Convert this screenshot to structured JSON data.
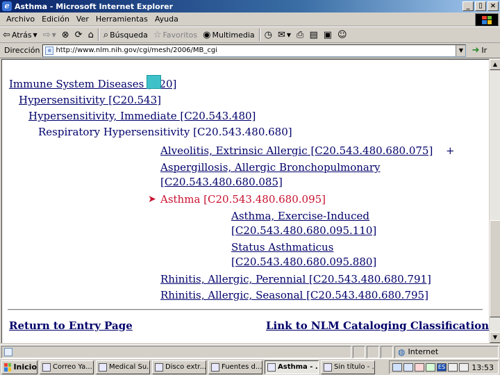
{
  "window": {
    "title": "Asthma - Microsoft Internet Explorer",
    "buttons": {
      "minimize": "_",
      "restore": "▯",
      "close": "×"
    }
  },
  "menu": [
    "Archivo",
    "Edición",
    "Ver",
    "Herramientas",
    "Ayuda"
  ],
  "toolbar": {
    "back": "Atrás",
    "search": "Búsqueda",
    "favorites": "Favoritos",
    "multimedia": "Multimedia"
  },
  "address": {
    "label": "Dirección",
    "url": "http://www.nlm.nih.gov/cgi/mesh/2006/MB_cgi",
    "go": "Ir"
  },
  "tree": {
    "items": [
      {
        "text": "Immune System Diseases [C20]",
        "level": 0,
        "state": "link"
      },
      {
        "text": "Hypersensitivity [C20.543]",
        "level": 1,
        "state": "link"
      },
      {
        "text": "Hypersensitivity, Immediate [C20.543.480]",
        "level": 2,
        "state": "link"
      },
      {
        "text": "Respiratory Hypersensitivity [C20.543.480.680]",
        "level": 3,
        "state": "plain"
      },
      {
        "text": "Alveolitis, Extrinsic Allergic [C20.543.480.680.075]",
        "suffix": "+",
        "level": 4,
        "state": "link"
      },
      {
        "text": "Aspergillosis, Allergic Bronchopulmonary",
        "level": 4,
        "state": "link"
      },
      {
        "text": "[C20.543.480.680.085]",
        "level": 4,
        "state": "link"
      },
      {
        "text": "Asthma [C20.543.480.680.095]",
        "marker": "➤",
        "level": 4,
        "state": "current"
      },
      {
        "text": "Asthma, Exercise-Induced",
        "level": 5,
        "state": "link"
      },
      {
        "text": "[C20.543.480.680.095.110]",
        "level": 5,
        "state": "link"
      },
      {
        "text": "Status Asthmaticus",
        "level": 5,
        "state": "link"
      },
      {
        "text": "[C20.543.480.680.095.880]",
        "level": 5,
        "state": "link"
      },
      {
        "text": "Rhinitis, Allergic, Perennial [C20.543.480.680.791]",
        "level": 4,
        "state": "link"
      },
      {
        "text": "Rhinitis, Allergic, Seasonal [C20.543.480.680.795]",
        "level": 4,
        "state": "link"
      }
    ]
  },
  "footer": {
    "return_link": "Return to Entry Page",
    "catalog_link": "Link to NLM Cataloging Classification"
  },
  "status": {
    "zone": "Internet"
  },
  "taskbar": {
    "start": "Inicio",
    "tasks": [
      "Correo Ya...",
      "Medical Su...",
      "Disco extr...",
      "Fuentes d...",
      "Asthma - ...",
      "Sin título - ..."
    ],
    "active_index": 4,
    "tray_lang": "ES",
    "clock": "13:53"
  },
  "colors": {
    "link": "#00006a",
    "current": "#c8102e",
    "titlebar": "#0a246a"
  }
}
